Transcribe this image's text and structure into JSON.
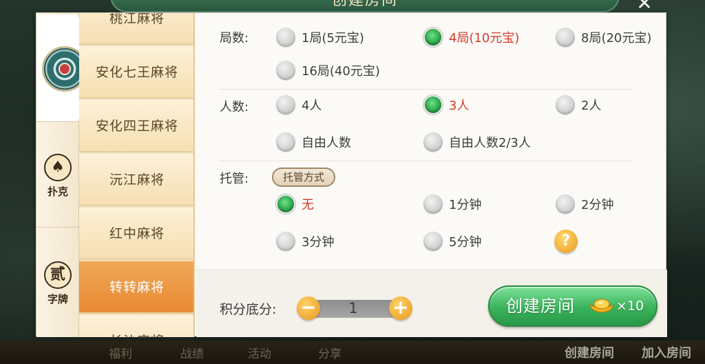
{
  "dialog": {
    "title": "创建房间",
    "close_glyph": "✕"
  },
  "categories": [
    {
      "label": "",
      "icon": "mahjong-tile-icon"
    },
    {
      "label": "扑克",
      "icon": "spade-icon",
      "glyph": "♠"
    },
    {
      "label": "字牌",
      "icon": "zipai-icon",
      "glyph": "贰"
    }
  ],
  "games": [
    {
      "label": "桃江麻将"
    },
    {
      "label": "安化七王麻将"
    },
    {
      "label": "安化四王麻将"
    },
    {
      "label": "沅江麻将"
    },
    {
      "label": "红中麻将"
    },
    {
      "label": "转转麻将",
      "active": true
    },
    {
      "label": "长沙麻将"
    }
  ],
  "rounds": {
    "label": "局数:",
    "options": [
      "1局(5元宝)",
      "4局(10元宝)",
      "8局(20元宝)",
      "16局(40元宝)"
    ],
    "selected": "4局(10元宝)"
  },
  "players": {
    "label": "人数:",
    "options": [
      "4人",
      "3人",
      "2人",
      "自由人数",
      "自由人数2/3人"
    ],
    "selected": "3人"
  },
  "trustee": {
    "label": "托管:",
    "mode_button": "托管方式",
    "options": [
      "无",
      "1分钟",
      "2分钟",
      "3分钟",
      "5分钟"
    ],
    "selected": "无",
    "help_glyph": "?"
  },
  "footer": {
    "score_label": "积分底分:",
    "score_value": "1",
    "minus": "−",
    "plus": "+",
    "create_label": "创建房间",
    "create_cost": "×10"
  },
  "bottom_bar": {
    "items": [
      "福利",
      "战绩",
      "活动",
      "分享"
    ],
    "create_room": "创建房间",
    "join_room": "加入房间"
  },
  "colors": {
    "selected_text": "#d43b2b",
    "active_tab": "#e98a34",
    "create_button": "#39b25a",
    "accent_gold": "#e8951c"
  }
}
